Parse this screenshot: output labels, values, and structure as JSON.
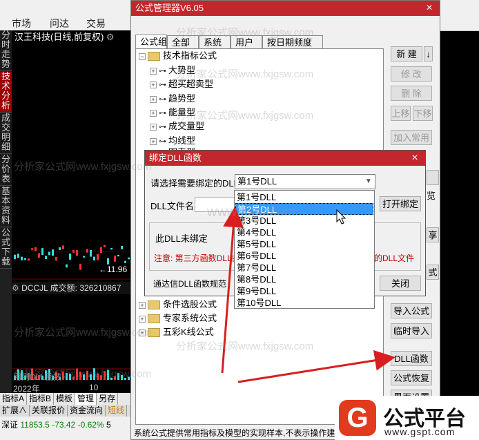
{
  "app": {
    "menu": [
      "市场",
      "问达",
      "交易"
    ],
    "stock_title": "汉王科技(日线,前复权)",
    "left_tabs": [
      "分时走势",
      "技术分析",
      "成交明细",
      "分价表",
      "基本资料",
      "公式下载"
    ],
    "price_label": "11.96",
    "indicator_label": "DCCJL 成交额: 326210867",
    "indicator_note": "用到DLL函数",
    "year_label": "2022年",
    "year_label2": "10",
    "bottom_tabs": [
      "指标A",
      "指标B",
      "模板",
      "管理",
      "另存"
    ],
    "bottom_tabs2": [
      "扩展∧",
      "关联报价",
      "资金流向",
      "短线"
    ],
    "status_index": "深证",
    "status_value": "11853.5",
    "status_change": "-73.42",
    "status_pct": "-0.62%",
    "status_extra": "5"
  },
  "formula_manager": {
    "title": "公式管理器V6.05",
    "close": "×",
    "tabs": [
      "公式组",
      "全部",
      "系统",
      "用户",
      "按日期频度"
    ],
    "tree": {
      "root": "技术指标公式",
      "children": [
        "大势型",
        "超买超卖型",
        "趋势型",
        "能量型",
        "成交量型",
        "均线型",
        "图表型"
      ],
      "others": [
        "条件选股公式",
        "专家系统公式",
        "五彩K线公式"
      ]
    },
    "buttons": {
      "new": "新 建",
      "new_arrow": "↓",
      "modify": "修 改",
      "delete": "删 除",
      "move_up": "上移",
      "move_down": "下移",
      "add_common": "加入常用",
      "partial_1": "览",
      "partial_2": "享",
      "partial_3": "式",
      "import": "导入公式",
      "temp_import": "临时导入",
      "dll_func": "DLL函数",
      "restore": "公式恢复",
      "interface": "界面设置"
    },
    "description": "系统公式提供常用指标及模型的实现样本,不表示操作建"
  },
  "dll_dialog": {
    "title": "绑定DLL函数",
    "close": "×",
    "select_label": "请选择需要绑定的DLL",
    "selected_value": "第1号DLL",
    "file_label": "DLL文件名",
    "open_bind": "打开绑定",
    "status_text": "此DLL未绑定",
    "notice": "注意: 第三方函数DLL由",
    "notice_tail": "的DLL文件",
    "spec_link": "通达信DLL函数规范",
    "close_btn": "关闭",
    "options": [
      "第1号DLL",
      "第2号DLL",
      "第3号DLL",
      "第4号DLL",
      "第5号DLL",
      "第6号DLL",
      "第7号DLL",
      "第8号DLL",
      "第9号DLL",
      "第10号DLL"
    ],
    "highlighted_index": 1
  },
  "watermark": {
    "text1": "分析家公式网www.fxjgsw.com",
    "text2": "www.gspt.com"
  },
  "logo": {
    "mark": "G",
    "name": "公式平台",
    "url": "www.gspt.com"
  },
  "colors": {
    "accent": "#c2272d",
    "selection": "#3399ff",
    "notice": "#c00000",
    "arrow": "#d81e1e",
    "logo_red": "#e23a1d"
  }
}
